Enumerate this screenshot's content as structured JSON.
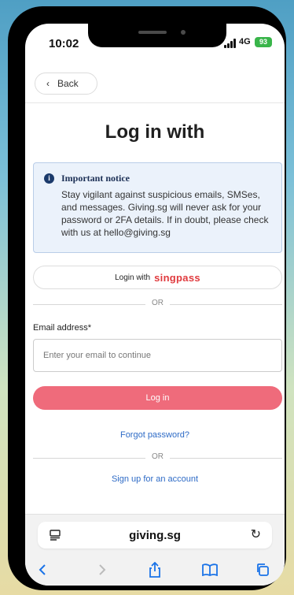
{
  "status": {
    "time": "10:02",
    "network": "4G",
    "battery": "93"
  },
  "nav": {
    "back_label": "Back"
  },
  "page": {
    "title": "Log in with"
  },
  "notice": {
    "title": "Important notice",
    "body": "Stay vigilant against suspicious emails, SMSes, and messages. Giving.sg will never ask for your password or 2FA details. If in doubt, please check with us at hello@giving.sg"
  },
  "singpass": {
    "prefix": "Login with",
    "brand": "singpass"
  },
  "divider1": "OR",
  "form": {
    "email_label": "Email address*",
    "email_placeholder": "Enter your email to continue",
    "email_value": "",
    "login_label": "Log in",
    "forgot_label": "Forgot password?"
  },
  "divider2": "OR",
  "signup_label": "Sign up for an account",
  "browser": {
    "url": "giving.sg"
  },
  "colors": {
    "accent": "#ef6b7b",
    "link": "#2e6bc6",
    "notice_bg": "#ebf2fb",
    "singpass": "#e03a3e"
  }
}
